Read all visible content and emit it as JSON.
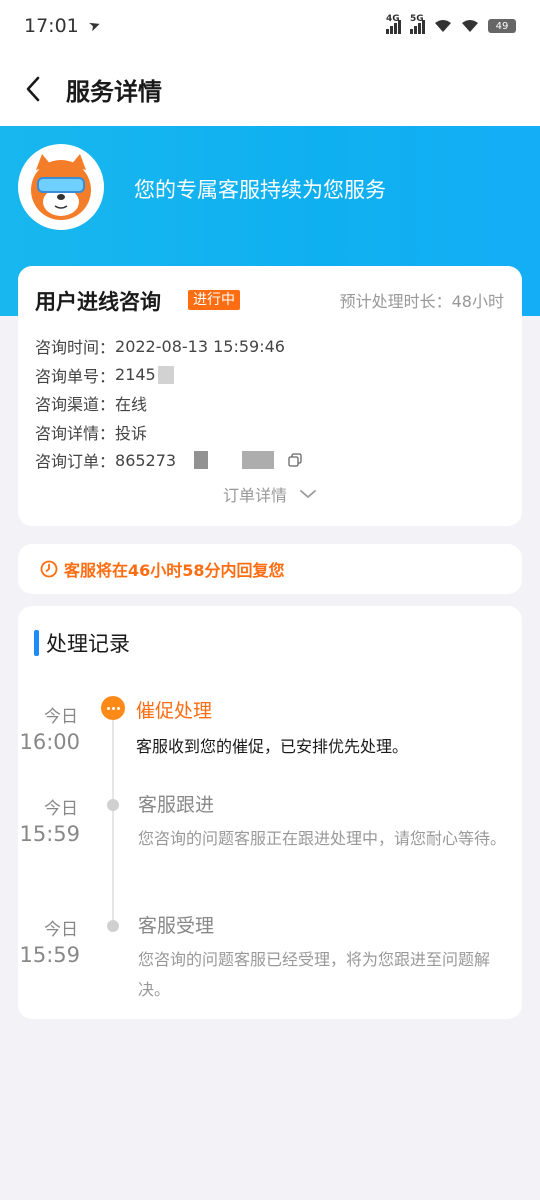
{
  "status_bar": {
    "time": "17:01",
    "net1": "4G",
    "net2": "5G",
    "battery": "49"
  },
  "header": {
    "title": "服务详情"
  },
  "banner": {
    "text": "您的专属客服持续为您服务"
  },
  "info": {
    "title": "用户进线咨询",
    "status": "进行中",
    "eta": "预计处理时长：48小时",
    "rows": [
      {
        "label": "咨询时间：",
        "value": "2022-08-13 15:59:46"
      },
      {
        "label": "咨询单号：",
        "value": "2145"
      },
      {
        "label": "咨询渠道：",
        "value": "在线"
      },
      {
        "label": "咨询详情：",
        "value": "投诉"
      },
      {
        "label": "咨询订单：",
        "value": "865273"
      }
    ],
    "order_detail": "订单详情"
  },
  "notice": {
    "text": "客服将在46小时58分内回复您"
  },
  "records": {
    "title": "处理记录",
    "entries": [
      {
        "day": "今日",
        "time": "16:00",
        "title": "催促处理",
        "desc": "客服收到您的催促，已安排优先处理。",
        "active": true
      },
      {
        "day": "今日",
        "time": "15:59",
        "title": "客服跟进",
        "desc": "您咨询的问题客服正在跟进处理中，请您耐心等待。",
        "active": false
      },
      {
        "day": "今日",
        "time": "15:59",
        "title": "客服受理",
        "desc": "您咨询的问题客服已经受理，将为您跟进至问题解决。",
        "active": false
      }
    ]
  },
  "colors": {
    "accent_orange": "#ff6d12",
    "banner_blue": "#14aef6",
    "title_bar_blue": "#1d8cf8"
  },
  "icons": [
    "back-arrow-icon",
    "airplane-mode-icon",
    "wifi-icon",
    "mascot-avatar",
    "copy-icon",
    "chevron-down-icon",
    "clock-icon",
    "more-dots-icon"
  ]
}
